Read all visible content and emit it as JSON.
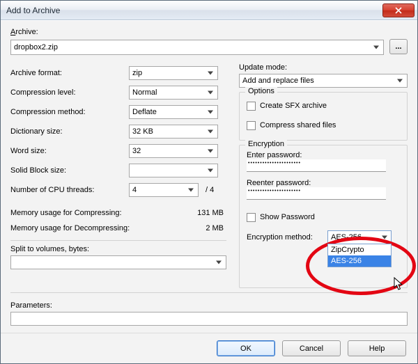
{
  "window": {
    "title": "Add to Archive"
  },
  "archive": {
    "label": "Archive:",
    "value": "dropbox2.zip",
    "browse": "..."
  },
  "left": {
    "format": {
      "label": "Archive format:",
      "value": "zip"
    },
    "level": {
      "label": "Compression level:",
      "value": "Normal"
    },
    "method": {
      "label": "Compression method:",
      "value": "Deflate"
    },
    "dict": {
      "label": "Dictionary size:",
      "value": "32 KB"
    },
    "word": {
      "label": "Word size:",
      "value": "32"
    },
    "block": {
      "label": "Solid Block size:",
      "value": ""
    },
    "threads": {
      "label": "Number of CPU threads:",
      "value": "4",
      "suffix": "/ 4"
    },
    "mem_comp": {
      "label": "Memory usage for Compressing:",
      "value": "131 MB"
    },
    "mem_decomp": {
      "label": "Memory usage for Decompressing:",
      "value": "2 MB"
    },
    "split": {
      "label": "Split to volumes, bytes:",
      "value": ""
    }
  },
  "right": {
    "update": {
      "label": "Update mode:",
      "value": "Add and replace files"
    },
    "options": {
      "title": "Options",
      "sfx": "Create SFX archive",
      "shared": "Compress shared files"
    },
    "encryption": {
      "title": "Encryption",
      "enter": "Enter password:",
      "reenter": "Reenter password:",
      "pw_mask": "••••••••••••••••••••••",
      "show": "Show Password",
      "method_label": "Encryption method:",
      "method_value": "AES-256",
      "options": [
        "ZipCrypto",
        "AES-256"
      ]
    }
  },
  "params": {
    "label": "Parameters:",
    "value": ""
  },
  "buttons": {
    "ok": "OK",
    "cancel": "Cancel",
    "help": "Help"
  }
}
